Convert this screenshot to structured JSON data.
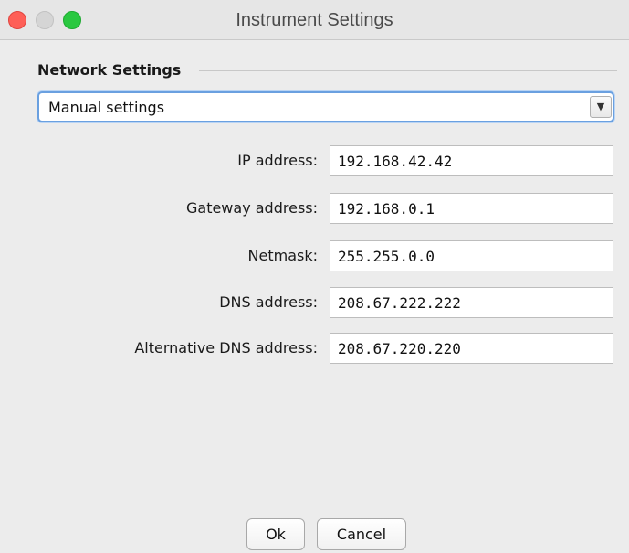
{
  "window": {
    "title": "Instrument Settings"
  },
  "network": {
    "section_title": "Network Settings",
    "mode": {
      "selected": "Manual settings"
    },
    "fields": {
      "ip": {
        "label": "IP address:",
        "value": "192.168.42.42"
      },
      "gateway": {
        "label": "Gateway address:",
        "value": "192.168.0.1"
      },
      "netmask": {
        "label": "Netmask:",
        "value": "255.255.0.0"
      },
      "dns": {
        "label": "DNS address:",
        "value": "208.67.222.222"
      },
      "alt_dns": {
        "label": "Alternative DNS address:",
        "value": "208.67.220.220"
      }
    }
  },
  "buttons": {
    "ok": "Ok",
    "cancel": "Cancel"
  },
  "icons": {
    "close": "close-icon",
    "minimize": "minimize-icon",
    "maximize": "maximize-icon",
    "dropdown": "chevron-down-icon"
  },
  "colors": {
    "close": "#fe5f57",
    "minimize": "#d5d5d5",
    "maximize": "#2ac840",
    "focus_ring": "#6aa0e0"
  }
}
